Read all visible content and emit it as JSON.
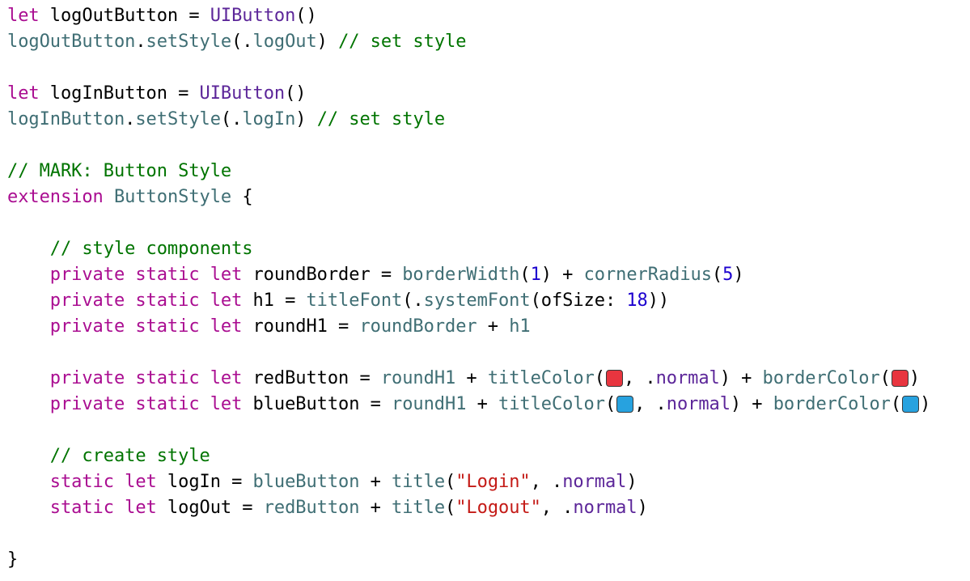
{
  "editor": {
    "lines": [
      [
        {
          "t": "kw",
          "s": "let"
        },
        {
          "t": "plain",
          "s": " logOutButton = "
        },
        {
          "t": "type",
          "s": "UIButton"
        },
        {
          "t": "plain",
          "s": "()"
        }
      ],
      [
        {
          "t": "var",
          "s": "logOutButton"
        },
        {
          "t": "plain",
          "s": "."
        },
        {
          "t": "var",
          "s": "setStyle"
        },
        {
          "t": "plain",
          "s": "(."
        },
        {
          "t": "var",
          "s": "logOut"
        },
        {
          "t": "plain",
          "s": ") "
        },
        {
          "t": "comment",
          "s": "// set style"
        }
      ],
      [],
      [
        {
          "t": "kw",
          "s": "let"
        },
        {
          "t": "plain",
          "s": " logInButton = "
        },
        {
          "t": "type",
          "s": "UIButton"
        },
        {
          "t": "plain",
          "s": "()"
        }
      ],
      [
        {
          "t": "var",
          "s": "logInButton"
        },
        {
          "t": "plain",
          "s": "."
        },
        {
          "t": "var",
          "s": "setStyle"
        },
        {
          "t": "plain",
          "s": "(."
        },
        {
          "t": "var",
          "s": "logIn"
        },
        {
          "t": "plain",
          "s": ") "
        },
        {
          "t": "comment",
          "s": "// set style"
        }
      ],
      [],
      [
        {
          "t": "comment",
          "s": "// MARK: Button Style"
        }
      ],
      [
        {
          "t": "kw",
          "s": "extension"
        },
        {
          "t": "plain",
          "s": " "
        },
        {
          "t": "var",
          "s": "ButtonStyle"
        },
        {
          "t": "plain",
          "s": " {"
        }
      ],
      [],
      [
        {
          "t": "plain",
          "s": "    "
        },
        {
          "t": "comment",
          "s": "// style components"
        }
      ],
      [
        {
          "t": "plain",
          "s": "    "
        },
        {
          "t": "kw",
          "s": "private static let"
        },
        {
          "t": "plain",
          "s": " roundBorder = "
        },
        {
          "t": "var",
          "s": "borderWidth"
        },
        {
          "t": "plain",
          "s": "("
        },
        {
          "t": "num",
          "s": "1"
        },
        {
          "t": "plain",
          "s": ") + "
        },
        {
          "t": "var",
          "s": "cornerRadius"
        },
        {
          "t": "plain",
          "s": "("
        },
        {
          "t": "num",
          "s": "5"
        },
        {
          "t": "plain",
          "s": ")"
        }
      ],
      [
        {
          "t": "plain",
          "s": "    "
        },
        {
          "t": "kw",
          "s": "private static let"
        },
        {
          "t": "plain",
          "s": " h1 = "
        },
        {
          "t": "var",
          "s": "titleFont"
        },
        {
          "t": "plain",
          "s": "(."
        },
        {
          "t": "var",
          "s": "systemFont"
        },
        {
          "t": "plain",
          "s": "(ofSize: "
        },
        {
          "t": "num",
          "s": "18"
        },
        {
          "t": "plain",
          "s": "))"
        }
      ],
      [
        {
          "t": "plain",
          "s": "    "
        },
        {
          "t": "kw",
          "s": "private static let"
        },
        {
          "t": "plain",
          "s": " roundH1 = "
        },
        {
          "t": "var",
          "s": "roundBorder"
        },
        {
          "t": "plain",
          "s": " + "
        },
        {
          "t": "var",
          "s": "h1"
        }
      ],
      [],
      [
        {
          "t": "plain",
          "s": "    "
        },
        {
          "t": "kw",
          "s": "private static let"
        },
        {
          "t": "plain",
          "s": " redButton = "
        },
        {
          "t": "var",
          "s": "roundH1"
        },
        {
          "t": "plain",
          "s": " + "
        },
        {
          "t": "var",
          "s": "titleColor"
        },
        {
          "t": "plain",
          "s": "("
        },
        {
          "t": "swatch",
          "color": "#e8353f",
          "name": "red-color-swatch-icon"
        },
        {
          "t": "plain",
          "s": ", ."
        },
        {
          "t": "member",
          "s": "normal"
        },
        {
          "t": "plain",
          "s": ") + "
        },
        {
          "t": "var",
          "s": "borderColor"
        },
        {
          "t": "plain",
          "s": "("
        },
        {
          "t": "swatch",
          "color": "#e8353f",
          "name": "red-color-swatch-icon"
        },
        {
          "t": "plain",
          "s": ")"
        }
      ],
      [
        {
          "t": "plain",
          "s": "    "
        },
        {
          "t": "kw",
          "s": "private static let"
        },
        {
          "t": "plain",
          "s": " blueButton = "
        },
        {
          "t": "var",
          "s": "roundH1"
        },
        {
          "t": "plain",
          "s": " + "
        },
        {
          "t": "var",
          "s": "titleColor"
        },
        {
          "t": "plain",
          "s": "("
        },
        {
          "t": "swatch",
          "color": "#27a2df",
          "name": "blue-color-swatch-icon"
        },
        {
          "t": "plain",
          "s": ", ."
        },
        {
          "t": "member",
          "s": "normal"
        },
        {
          "t": "plain",
          "s": ") + "
        },
        {
          "t": "var",
          "s": "borderColor"
        },
        {
          "t": "plain",
          "s": "("
        },
        {
          "t": "swatch",
          "color": "#27a2df",
          "name": "blue-color-swatch-icon"
        },
        {
          "t": "plain",
          "s": ")"
        }
      ],
      [],
      [
        {
          "t": "plain",
          "s": "    "
        },
        {
          "t": "comment",
          "s": "// create style"
        }
      ],
      [
        {
          "t": "plain",
          "s": "    "
        },
        {
          "t": "kw",
          "s": "static let"
        },
        {
          "t": "plain",
          "s": " logIn = "
        },
        {
          "t": "var",
          "s": "blueButton"
        },
        {
          "t": "plain",
          "s": " + "
        },
        {
          "t": "var",
          "s": "title"
        },
        {
          "t": "plain",
          "s": "("
        },
        {
          "t": "str",
          "s": "\"Login\""
        },
        {
          "t": "plain",
          "s": ", ."
        },
        {
          "t": "member",
          "s": "normal"
        },
        {
          "t": "plain",
          "s": ")"
        }
      ],
      [
        {
          "t": "plain",
          "s": "    "
        },
        {
          "t": "kw",
          "s": "static let"
        },
        {
          "t": "plain",
          "s": " logOut = "
        },
        {
          "t": "var",
          "s": "redButton"
        },
        {
          "t": "plain",
          "s": " + "
        },
        {
          "t": "var",
          "s": "title"
        },
        {
          "t": "plain",
          "s": "("
        },
        {
          "t": "str",
          "s": "\"Logout\""
        },
        {
          "t": "plain",
          "s": ", ."
        },
        {
          "t": "member",
          "s": "normal"
        },
        {
          "t": "plain",
          "s": ")"
        }
      ],
      [],
      [
        {
          "t": "plain",
          "s": "}"
        }
      ]
    ]
  },
  "colors": {
    "keyword": "#aa0d91",
    "type": "#5c2699",
    "variable": "#3f6e74",
    "comment": "#007400",
    "number": "#1c00cf",
    "string": "#c41a16",
    "swatch_red": "#e8353f",
    "swatch_blue": "#27a2df"
  }
}
